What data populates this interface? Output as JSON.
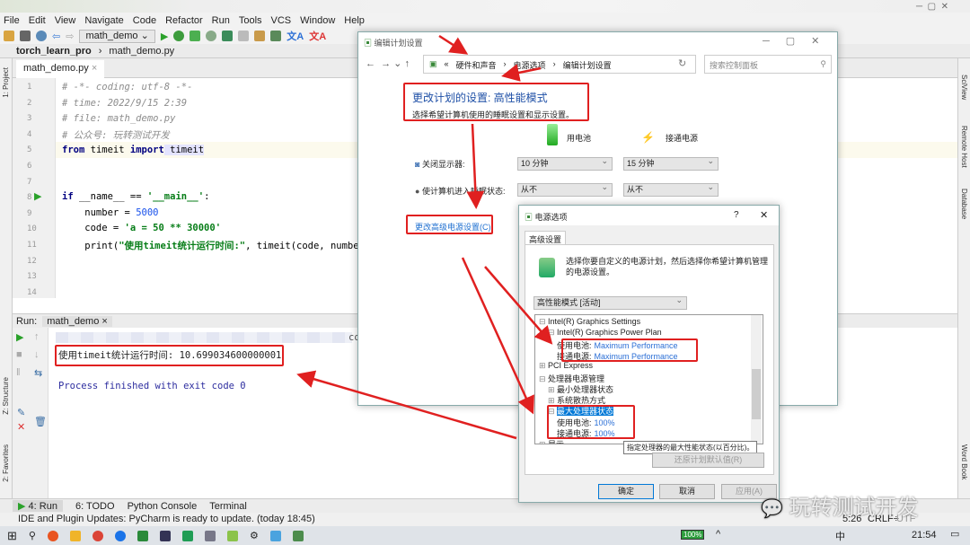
{
  "ide": {
    "menu": [
      "File",
      "Edit",
      "View",
      "Navigate",
      "Code",
      "Refactor",
      "Run",
      "Tools",
      "VCS",
      "Window",
      "Help"
    ],
    "run_config": "math_demo",
    "breadcrumb": [
      "torch_learn_pro",
      "math_demo.py"
    ],
    "editor_tab": "math_demo.py",
    "left_tools": [
      "1: Project",
      "Z: Structure",
      "2: Favorites"
    ],
    "right_tools": [
      "SciView",
      "Remote Host",
      "Database",
      "Word Book"
    ],
    "line_numbers": [
      "1",
      "2",
      "3",
      "4",
      "5",
      "6",
      "7",
      "8",
      "9",
      "10",
      "11",
      "12",
      "13",
      "14"
    ],
    "code": {
      "l1": "# -*- coding: utf-8 -*-",
      "l2": "# time: 2022/9/15 2:39",
      "l3": "# file: math_demo.py",
      "l4": "# 公众号: 玩转测试开发",
      "l5a": "from",
      "l5b": " timeit ",
      "l5c": "import",
      "l5d": " timeit",
      "l8a": "if",
      "l8b": " __name__ == ",
      "l8c": "'__main__'",
      "l8d": ":",
      "l9a": "    number = ",
      "l9b": "5000",
      "l10a": "    code = ",
      "l10b": "'a = 50 ** 30000'",
      "l11a": "    print(",
      "l11b": "\"使用timeit统计运行时间:\"",
      "l11c": ", timeit(code, number="
    },
    "run": {
      "label": "Run:",
      "tab": "math_demo",
      "output_line": "使用timeit统计运行时间: 10.699034600000001",
      "exit_line": "Process finished with exit code 0",
      "cut_text": "co"
    },
    "tool_tabs": [
      "4: Run",
      "6: TODO",
      "Python Console",
      "Terminal"
    ],
    "status_message": "IDE and Plugin Updates: PyCharm is ready to update. (today 18:45)",
    "status_right": [
      "5:26",
      "CRLF÷",
      "UTF"
    ]
  },
  "control_panel": {
    "title": "编辑计划设置",
    "address": [
      "«",
      "硬件和声音",
      "电源选项",
      "编辑计划设置"
    ],
    "search_placeholder": "搜索控制面板",
    "heading": "更改计划的设置: 高性能模式",
    "subheading": "选择希望计算机使用的睡眠设置和显示设置。",
    "col_battery": "用电池",
    "col_plugged": "接通电源",
    "rows": [
      {
        "label": "关闭显示器:",
        "battery": "10 分钟",
        "plugged": "15 分钟"
      },
      {
        "label": "使计算机进入睡眠状态:",
        "battery": "从不",
        "plugged": "从不"
      }
    ],
    "advanced_link": "更改高级电源设置(C)"
  },
  "power_options": {
    "title": "电源选项",
    "help": "?",
    "tab": "高级设置",
    "description": "选择你要自定义的电源计划，然后选择你希望计算机管理的电源设置。",
    "plan": "高性能模式 [活动]",
    "tree": [
      {
        "text": "Intel(R) Graphics Settings",
        "value": ""
      },
      {
        "text": "Intel(R) Graphics Power Plan",
        "value": ""
      },
      {
        "text": "使用电池:",
        "value": "Maximum Performance"
      },
      {
        "text": "接通电源:",
        "value": "Maximum Performance"
      },
      {
        "text": "PCI Express",
        "value": ""
      },
      {
        "text": "处理器电源管理",
        "value": ""
      },
      {
        "text": "最小处理器状态",
        "value": ""
      },
      {
        "text": "系统散热方式",
        "value": ""
      },
      {
        "text": "最大处理器状态",
        "value": ""
      },
      {
        "text": "使用电池:",
        "value": "100%"
      },
      {
        "text": "接通电源:",
        "value": "100%"
      },
      {
        "text": "显示",
        "value": ""
      }
    ],
    "tooltip": "指定处理器的最大性能状态(以百分比)。",
    "restore": "还原计划默认值(R)",
    "ok": "确定",
    "cancel": "取消",
    "apply": "应用(A)"
  },
  "watermark": "玩转测试开发",
  "taskbar": {
    "battery": "100%",
    "clock": "21:54",
    "ime": "中"
  },
  "colors": {
    "annotation_red": "#e02020",
    "link_blue": "#2b6fd6",
    "run_green": "#2aa12a"
  }
}
